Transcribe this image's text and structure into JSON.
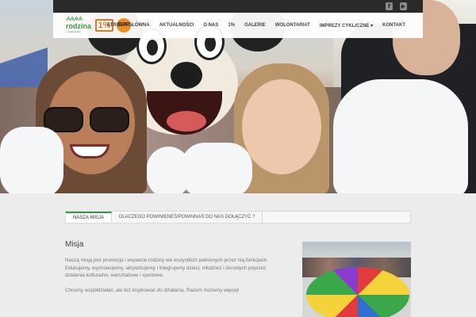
{
  "social": {
    "facebook_glyph": "f",
    "youtube_glyph": "▶"
  },
  "logo": {
    "people": "ѦѦѦѦ",
    "word": "rodzina",
    "tagline": "z wychowania"
  },
  "badges": {
    "one_percent": "1%",
    "opp": "OPP"
  },
  "nav": {
    "items": [
      {
        "label": "STRONA GŁÓWNA"
      },
      {
        "label": "AKTUALNOŚCI"
      },
      {
        "label": "O NAS"
      },
      {
        "label": "1%"
      },
      {
        "label": "GALERIE"
      },
      {
        "label": "WOLONTARIAT"
      },
      {
        "label": "IMPREZY CYKLICZNE ▾"
      },
      {
        "label": "KONTAKT"
      }
    ]
  },
  "tabs": [
    {
      "label": "NASZA MISJA",
      "active": true
    },
    {
      "label": "DLACZEGO POWINIENEŚ/POWINNAŚ DO NAS DOŁĄCZYĆ ?",
      "active": false
    }
  ],
  "content": {
    "title": "Misja",
    "paragraph1": "Naszą misją jest promocja i wsparcie rodziny we wszystkich pełnionych przez nią funkcjach. Edukujemy, wychowujemy, aktywizujemy i integrujemy dzieci, młodzież i dorosłych poprzez działania kulturalne, warsztatowe i sportowe.",
    "paragraph2": "Chcemy współdziałać, ale też inspirować do działania. Razem możemy więcej!"
  },
  "colors": {
    "accent": "#2e9b3e",
    "orange": "#e07a1e",
    "topbar": "#2a2a2a"
  }
}
